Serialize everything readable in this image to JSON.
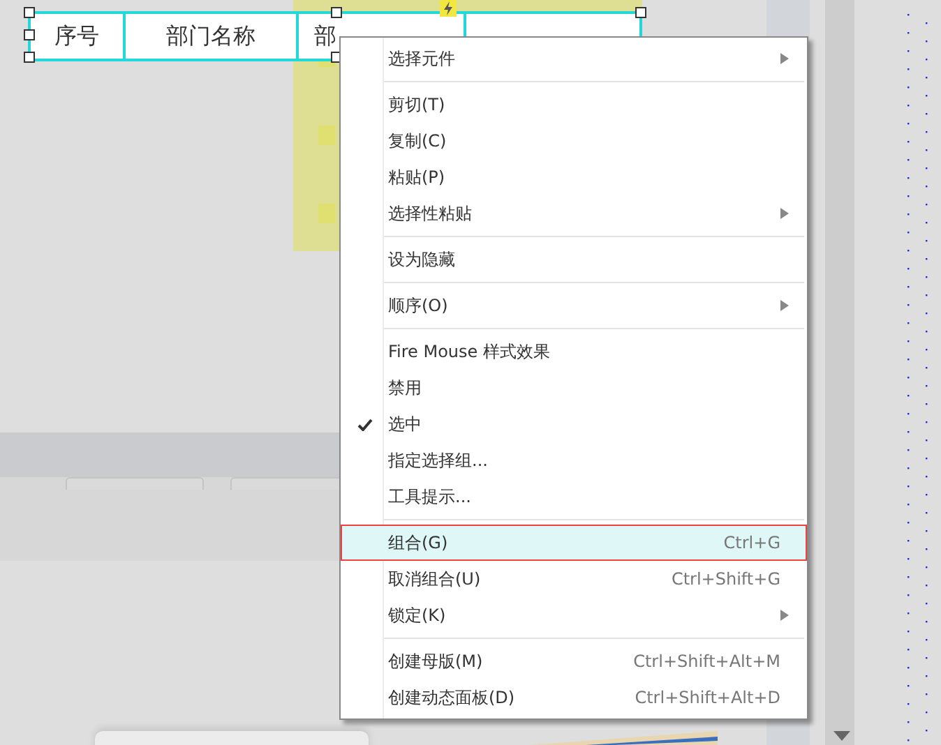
{
  "table": {
    "columns": [
      {
        "label": "序号"
      },
      {
        "label": "部门名称"
      },
      {
        "label": "部"
      },
      {}
    ]
  },
  "context_menu": {
    "items": [
      {
        "kind": "item",
        "label": "选择元件",
        "submenu": true,
        "checked": false,
        "selected": false
      },
      {
        "kind": "separator"
      },
      {
        "kind": "item",
        "label": "剪切(T)",
        "submenu": false,
        "checked": false,
        "selected": false
      },
      {
        "kind": "item",
        "label": "复制(C)",
        "submenu": false,
        "checked": false,
        "selected": false
      },
      {
        "kind": "item",
        "label": "粘贴(P)",
        "submenu": false,
        "checked": false,
        "selected": false
      },
      {
        "kind": "item",
        "label": "选择性粘贴",
        "submenu": true,
        "checked": false,
        "selected": false
      },
      {
        "kind": "separator"
      },
      {
        "kind": "item",
        "label": "设为隐藏",
        "submenu": false,
        "checked": false,
        "selected": false
      },
      {
        "kind": "separator"
      },
      {
        "kind": "item",
        "label": "顺序(O)",
        "submenu": true,
        "checked": false,
        "selected": false
      },
      {
        "kind": "separator"
      },
      {
        "kind": "item",
        "label": "Fire Mouse 样式效果",
        "submenu": false,
        "checked": false,
        "selected": false
      },
      {
        "kind": "item",
        "label": "禁用",
        "submenu": false,
        "checked": false,
        "selected": false
      },
      {
        "kind": "item",
        "label": "选中",
        "submenu": false,
        "checked": true,
        "selected": false
      },
      {
        "kind": "item",
        "label": "指定选择组...",
        "submenu": false,
        "checked": false,
        "selected": false
      },
      {
        "kind": "item",
        "label": "工具提示...",
        "submenu": false,
        "checked": false,
        "selected": false
      },
      {
        "kind": "separator"
      },
      {
        "kind": "item",
        "label": "组合(G)",
        "shortcut": "Ctrl+G",
        "submenu": false,
        "checked": false,
        "selected": true
      },
      {
        "kind": "item",
        "label": "取消组合(U)",
        "shortcut": "Ctrl+Shift+G",
        "submenu": false,
        "checked": false,
        "selected": false
      },
      {
        "kind": "item",
        "label": "锁定(K)",
        "submenu": true,
        "checked": false,
        "selected": false
      },
      {
        "kind": "separator"
      },
      {
        "kind": "item",
        "label": "创建母版(M)",
        "shortcut": "Ctrl+Shift+Alt+M",
        "submenu": false,
        "checked": false,
        "selected": false
      },
      {
        "kind": "item",
        "label": "创建动态面板(D)",
        "shortcut": "Ctrl+Shift+Alt+D",
        "submenu": false,
        "checked": false,
        "selected": false
      }
    ]
  }
}
